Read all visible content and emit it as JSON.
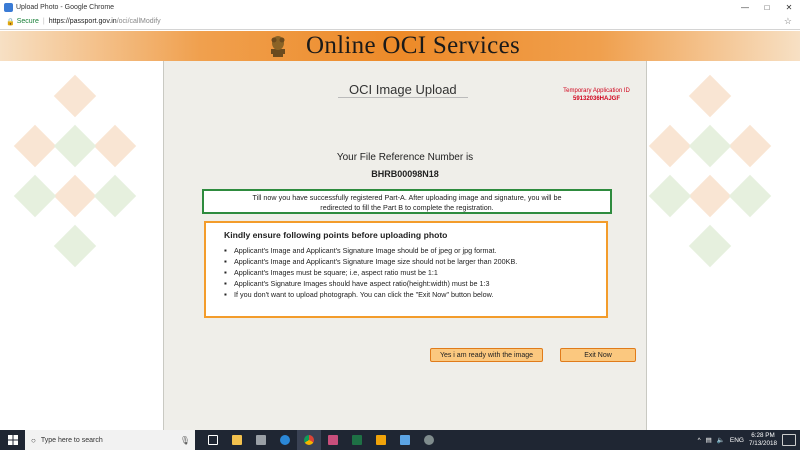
{
  "window": {
    "title": "Upload Photo - Google Chrome",
    "min_icon": "minimize-icon",
    "max_icon": "maximize-icon",
    "close_icon": "close-icon"
  },
  "address": {
    "secure_label": "Secure",
    "url_base": "https://passport.gov.in",
    "url_path": "/oci/callModify"
  },
  "banner": {
    "brand": "Online OCI Services",
    "emblem_icon": "national-emblem-icon"
  },
  "page": {
    "heading": "OCI Image Upload",
    "temp_id_label": "Temporary Application ID",
    "temp_id_value": "59132036HAJGF",
    "ref_label": "Your File Reference Number is",
    "ref_number": "BHRB00098N18",
    "notice_line1": "Till now you have successfully registered Part-A. After uploading image and signature, you will be",
    "notice_line2": "redirected to fill the Part B to complete the registration.",
    "instructions_title": "Kindly ensure following points before uploading photo",
    "instructions": [
      "Applicant's Image and Applicant's Signature Image should be of jpeg or jpg format.",
      "Applicant's Image and Applicant's Signature Image size should not be larger than 200KB.",
      "Applicant's Images must be square; i.e, aspect ratio must be 1:1",
      "Applicant's Signature Images should have aspect ratio(height:width) must be 1:3",
      "If you don't want to upload photograph. You can click the \"Exit Now\" button below."
    ],
    "ready_button": "Yes i am ready with the image",
    "exit_button": "Exit Now"
  },
  "taskbar": {
    "search_placeholder": "Type here to search",
    "lang": "ENG",
    "time": "6:28 PM",
    "date": "7/13/2018"
  },
  "colors": {
    "banner_orange": "#ed8a28",
    "notice_border": "#2e8b3e",
    "instructions_border": "#f39c2b",
    "button_fill": "#fbc87f",
    "temp_id_red": "#d0021b"
  }
}
